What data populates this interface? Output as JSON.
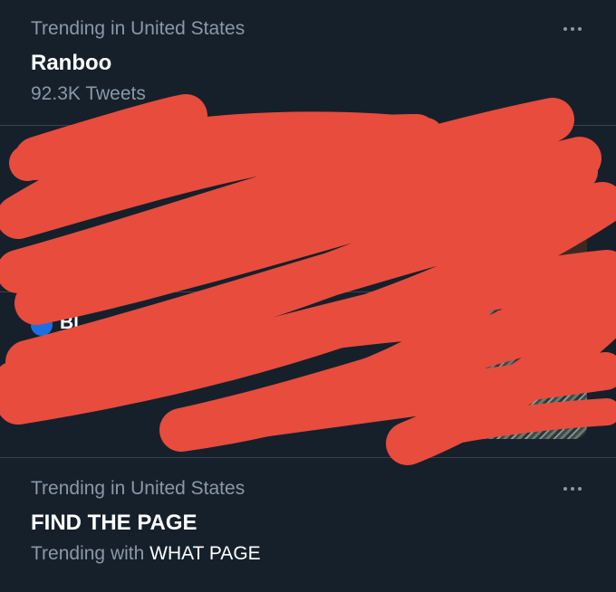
{
  "trends": [
    {
      "context": "Trending in United States",
      "title": "Ranboo",
      "tweet_count": "92.3K Tweets"
    },
    {
      "context": "Trending in United States",
      "title": "FIND THE PAGE",
      "trending_with_prefix": "Trending with",
      "trending_with_term": "WHAT PAGE"
    }
  ],
  "redacted_cards": [
    {
      "visible_label": "Bl"
    }
  ],
  "colors": {
    "background": "#15202b",
    "divider": "#38444d",
    "muted_text": "#8b98a5",
    "primary_text": "#ffffff",
    "redaction": "#e84c3d"
  },
  "icons": {
    "more": "more-horizontal-icon"
  }
}
